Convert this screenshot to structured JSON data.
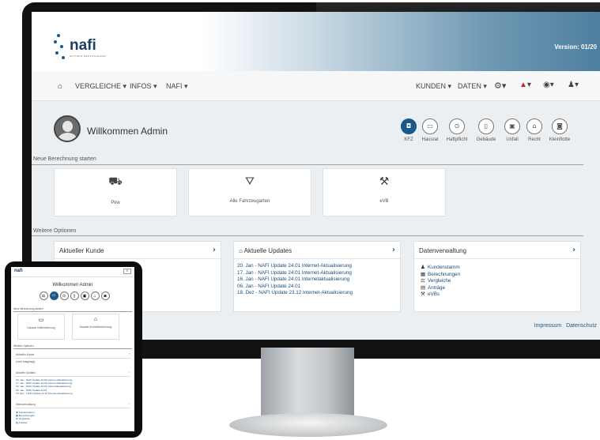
{
  "app": {
    "logo_text": "nafi",
    "logo_sub": "ACTURIS DEUTSCHLAND",
    "version": "Version: 01/20"
  },
  "nav": {
    "home_icon": "home-icon",
    "items_left": [
      "VERGLEICHE",
      "INFOS",
      "NAFI"
    ],
    "items_right": [
      "KUNDEN",
      "DATEN"
    ],
    "icons_right": [
      "gear-icon",
      "warning-icon",
      "eye-icon",
      "user-icon"
    ]
  },
  "welcome": {
    "text": "Willkommen Admin"
  },
  "categories": [
    {
      "label": "KFZ",
      "icon": "car-icon",
      "active": true
    },
    {
      "label": "Hausrat",
      "icon": "bed-icon"
    },
    {
      "label": "Haftpflicht",
      "icon": "shield-icon"
    },
    {
      "label": "Gebäude",
      "icon": "building-icon"
    },
    {
      "label": "Unfall",
      "icon": "medkit-icon"
    },
    {
      "label": "Recht",
      "icon": "bank-icon"
    },
    {
      "label": "Kleinflotte",
      "icon": "cars-icon"
    }
  ],
  "new_calc": {
    "title": "Neue Berechnung starten",
    "tiles": [
      {
        "label": "Pkw",
        "icon": "car-icon"
      },
      {
        "label": "Alle Fahrzeugarten",
        "icon": "road-icon"
      },
      {
        "label": "eVB",
        "icon": "gavel-icon"
      }
    ]
  },
  "more": {
    "title": "Weitere Optionen",
    "panels": {
      "kunde": {
        "title": "Aktueller Kunde"
      },
      "updates": {
        "title": "Aktuelle Updates",
        "items": [
          "20. Jan - NAFI Update 24.01 Internet-Aktualisierung",
          "17. Jan - NAFI Update 24.01 Internet-Aktualisierung",
          "16. Jan - NAFI Update 24.01 Internetaktualisierung",
          "06. Jan - NAFI Update 24.01",
          "18. Dez - NAFI Update 23.12 Internet-Aktualisierung"
        ]
      },
      "daten": {
        "title": "Datenverwaltung",
        "items": [
          "Kundenstamm",
          "Berechnungen",
          "Vergleiche",
          "Anträge",
          "eVBs"
        ]
      }
    }
  },
  "footer": {
    "impressum": "Impressum",
    "datenschutz": "Datenschutz"
  },
  "tablet": {
    "welcome": "Willkommen Admin",
    "section_new": "Neue Berechnung starten",
    "tiles": [
      "Hausrat Vollberechnung",
      "Hausrat Schnellberechnung"
    ],
    "section_more": "Weitere Optionen",
    "kunde": "Aktueller Kunde",
    "kunde_sub": "(nicht festgelegt)",
    "updates": "Aktuelle Updates",
    "update_items": [
      "20. Jan - NAFI Update 24.01 Internet-Aktualisierung",
      "17. Jan - NAFI Update 24.01 Internet-Aktualisierung",
      "16. Jan - NAFI Update 24.01 Internetaktualisierung",
      "06. Jan - NAFI Update 24.01",
      "18. Dez - NAFI Update 23.12 Internet-Aktualisierung"
    ],
    "daten": "Datenverwaltung",
    "daten_items": [
      "Kundenstamm",
      "Berechnungen",
      "Vergleiche",
      "Anträge"
    ]
  }
}
